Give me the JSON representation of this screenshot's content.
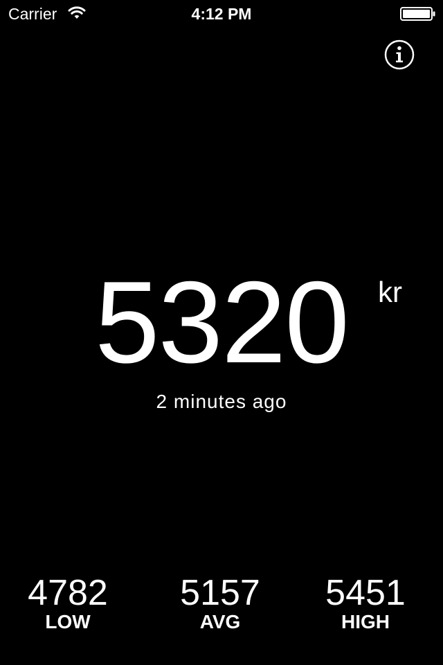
{
  "status_bar": {
    "carrier": "Carrier",
    "time": "4:12 PM",
    "wifi_icon": "wifi-icon",
    "battery_icon": "battery-full-icon"
  },
  "info_button": {
    "icon": "info-icon"
  },
  "price": {
    "value": "5320",
    "currency": "kr",
    "updated": "2 minutes ago"
  },
  "stats": [
    {
      "value": "4782",
      "label": "LOW"
    },
    {
      "value": "5157",
      "label": "AVG"
    },
    {
      "value": "5451",
      "label": "HIGH"
    }
  ],
  "colors": {
    "background": "#000000",
    "foreground": "#ffffff"
  }
}
